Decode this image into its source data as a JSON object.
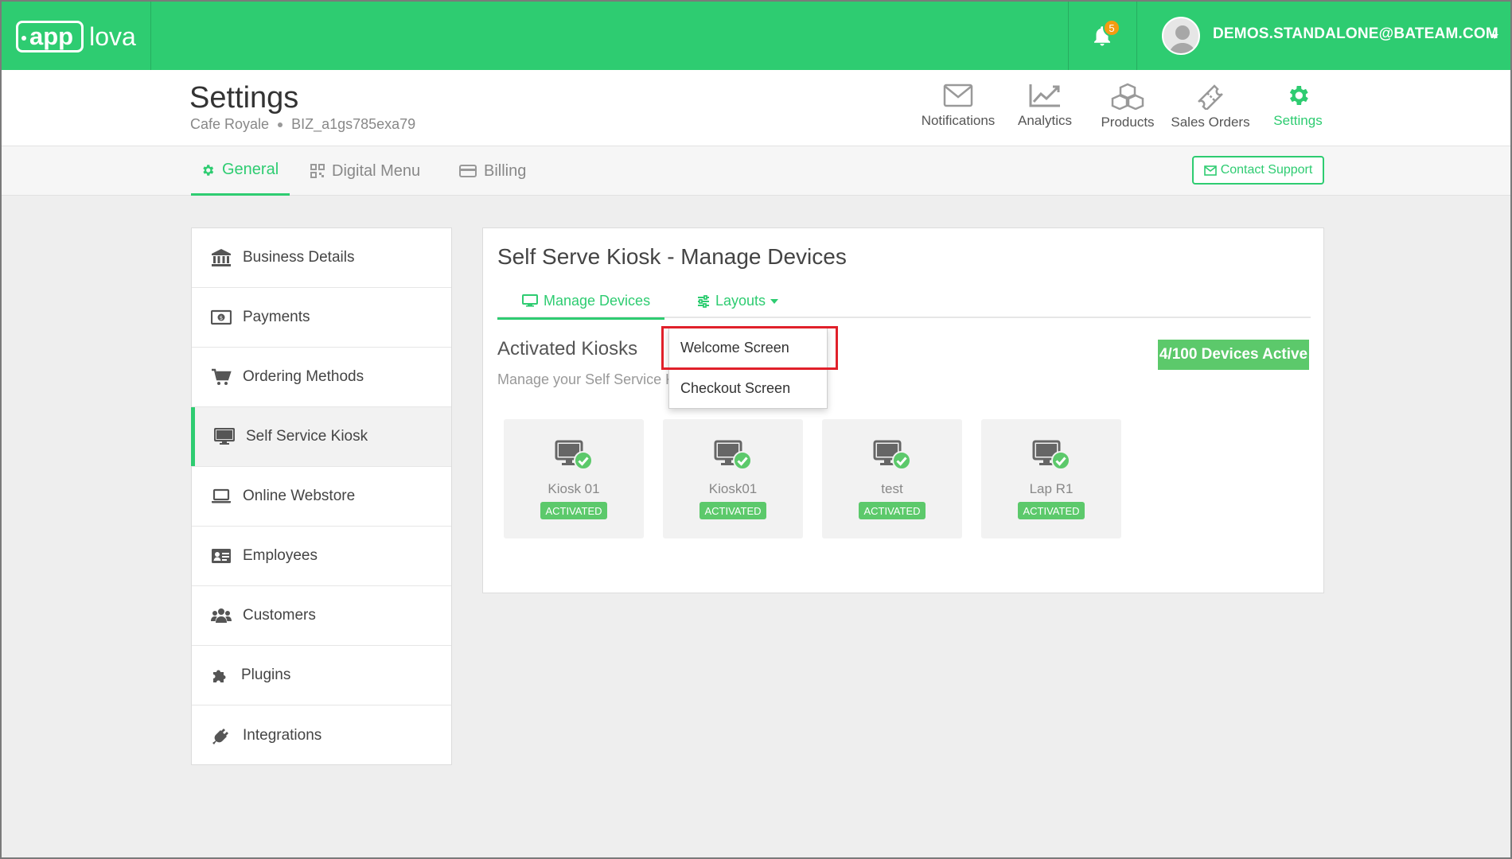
{
  "topbar": {
    "logo_box": "app",
    "logo_rest": "lova",
    "notification_count": "5",
    "user_email": "DEMOS.STANDALONE@BATEAM.COM"
  },
  "header": {
    "title": "Settings",
    "business_name": "Cafe Royale",
    "business_id": "BIZ_a1gs785exa79",
    "nav": [
      {
        "label": "Notifications",
        "icon": "envelope-icon"
      },
      {
        "label": "Analytics",
        "icon": "line-chart-icon"
      },
      {
        "label": "Products",
        "icon": "cubes-icon"
      },
      {
        "label": "Sales Orders",
        "icon": "ticket-icon"
      },
      {
        "label": "Settings",
        "icon": "gear-icon",
        "active": true
      }
    ]
  },
  "tabs": {
    "items": [
      {
        "label": "General",
        "icon": "gear-icon",
        "active": true
      },
      {
        "label": "Digital Menu",
        "icon": "qrcode-icon"
      },
      {
        "label": "Billing",
        "icon": "credit-card-icon"
      }
    ],
    "contact_support": "Contact Support"
  },
  "sidebar": {
    "items": [
      {
        "label": "Business Details",
        "icon": "bank-icon"
      },
      {
        "label": "Payments",
        "icon": "money-icon"
      },
      {
        "label": "Ordering Methods",
        "icon": "cart-icon"
      },
      {
        "label": "Self Service Kiosk",
        "icon": "desktop-icon",
        "active": true
      },
      {
        "label": "Online Webstore",
        "icon": "laptop-icon"
      },
      {
        "label": "Employees",
        "icon": "id-card-icon"
      },
      {
        "label": "Customers",
        "icon": "users-icon"
      },
      {
        "label": "Plugins",
        "icon": "puzzle-icon"
      },
      {
        "label": "Integrations",
        "icon": "plug-icon"
      }
    ]
  },
  "panel": {
    "title": "Self Serve Kiosk - Manage Devices",
    "subtabs": {
      "manage_devices": "Manage Devices",
      "layouts": "Layouts"
    },
    "section_title": "Activated Kiosks",
    "section_sub": "Manage your Self Service Ki",
    "devices_active": "4/100 Devices Active",
    "kiosks": [
      {
        "name": "Kiosk 01",
        "status": "ACTIVATED"
      },
      {
        "name": "Kiosk01",
        "status": "ACTIVATED"
      },
      {
        "name": "test",
        "status": "ACTIVATED"
      },
      {
        "name": "Lap R1",
        "status": "ACTIVATED"
      }
    ],
    "layouts_menu": [
      "Welcome Screen",
      "Checkout Screen"
    ]
  },
  "colors": {
    "brand": "#2ecc71",
    "badge": "#f39c12",
    "activated": "#5cc96b",
    "highlight": "#e0202a"
  }
}
